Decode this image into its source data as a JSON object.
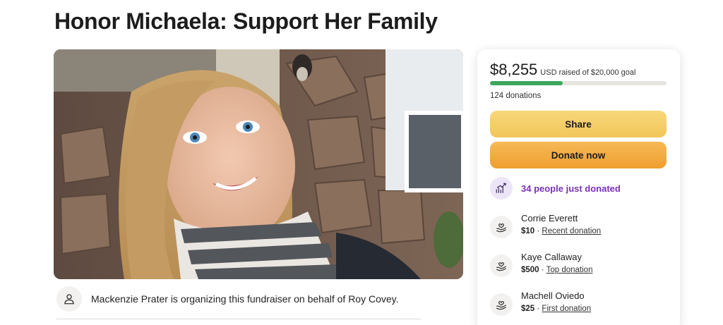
{
  "page": {
    "title": "Honor Michaela: Support Her Family"
  },
  "organizer": {
    "text": "Mackenzie Prater is organizing this fundraiser on behalf of Roy Covey."
  },
  "donation_card": {
    "raised_amount": "$8,255",
    "goal_text": "USD raised of $20,000 goal",
    "progress_fraction": 0.41,
    "donations_count": "124 donations",
    "share_label": "Share",
    "donate_label": "Donate now",
    "trend_text": "34 people just donated",
    "donors": [
      {
        "name": "Corrie Everett",
        "amount": "$10",
        "separator": " · ",
        "tag": "Recent donation"
      },
      {
        "name": "Kaye Callaway",
        "amount": "$500",
        "separator": " · ",
        "tag": "Top donation"
      },
      {
        "name": "Machell Oviedo",
        "amount": "$25",
        "separator": " · ",
        "tag": "First donation"
      }
    ]
  },
  "colors": {
    "progress": "#3ea65d",
    "share_button": "#f2c65a",
    "donate_button": "#ef9f2f",
    "trend_text": "#7b2fbe"
  },
  "icons": {
    "organizer": "user-icon",
    "trend": "trending-up-icon",
    "donor": "heart-hand-icon"
  }
}
